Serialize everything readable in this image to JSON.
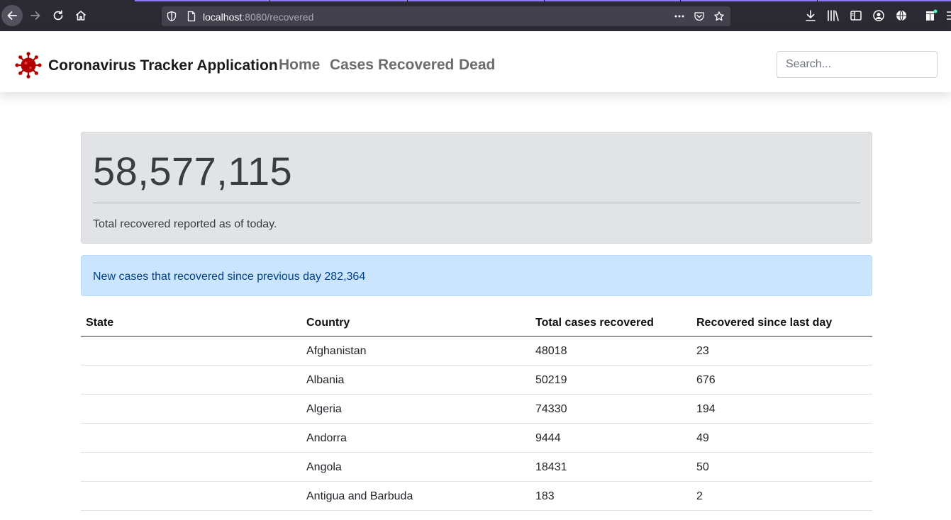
{
  "browser": {
    "url_host": "localhost",
    "url_path": ":8080/recovered"
  },
  "navbar": {
    "brand": "Coronavirus Tracker Application",
    "links": [
      {
        "label": "Home"
      },
      {
        "label": "Cases"
      },
      {
        "label": "Recovered"
      },
      {
        "label": "Dead"
      }
    ],
    "search_placeholder": "Search..."
  },
  "summary": {
    "total_recovered": "58,577,115",
    "caption": "Total recovered reported as of today."
  },
  "alert": {
    "text": "New cases that recovered since previous day 282,364"
  },
  "table": {
    "headers": [
      "State",
      "Country",
      "Total cases recovered",
      "Recovered since last day"
    ],
    "rows": [
      {
        "state": "",
        "country": "Afghanistan",
        "total": "48018",
        "since": "23"
      },
      {
        "state": "",
        "country": "Albania",
        "total": "50219",
        "since": "676"
      },
      {
        "state": "",
        "country": "Algeria",
        "total": "74330",
        "since": "194"
      },
      {
        "state": "",
        "country": "Andorra",
        "total": "9444",
        "since": "49"
      },
      {
        "state": "",
        "country": "Angola",
        "total": "18431",
        "since": "50"
      },
      {
        "state": "",
        "country": "Antigua and Barbuda",
        "total": "183",
        "since": "2"
      }
    ]
  },
  "colors": {
    "chrome_bg": "#2b2a33",
    "url_bar_bg": "#42414d",
    "logo_red": "#b30000",
    "jumbotron_bg": "#e2e3e5",
    "alert_bg": "#cce5ff",
    "alert_text": "#004085"
  },
  "icons": {
    "back": "arrow-left-icon",
    "forward": "arrow-right-icon",
    "reload": "reload-icon",
    "home": "home-icon",
    "site_info": "shield-icon",
    "page": "page-icon",
    "more": "ellipsis-icon",
    "pocket": "pocket-icon",
    "bookmark": "star-icon",
    "downloads": "download-icon",
    "library": "library-icon",
    "sidebar": "sidebar-icon",
    "account": "account-icon",
    "language": "globe-icon",
    "extensions": "extension-icon",
    "logo": "virus-icon"
  }
}
